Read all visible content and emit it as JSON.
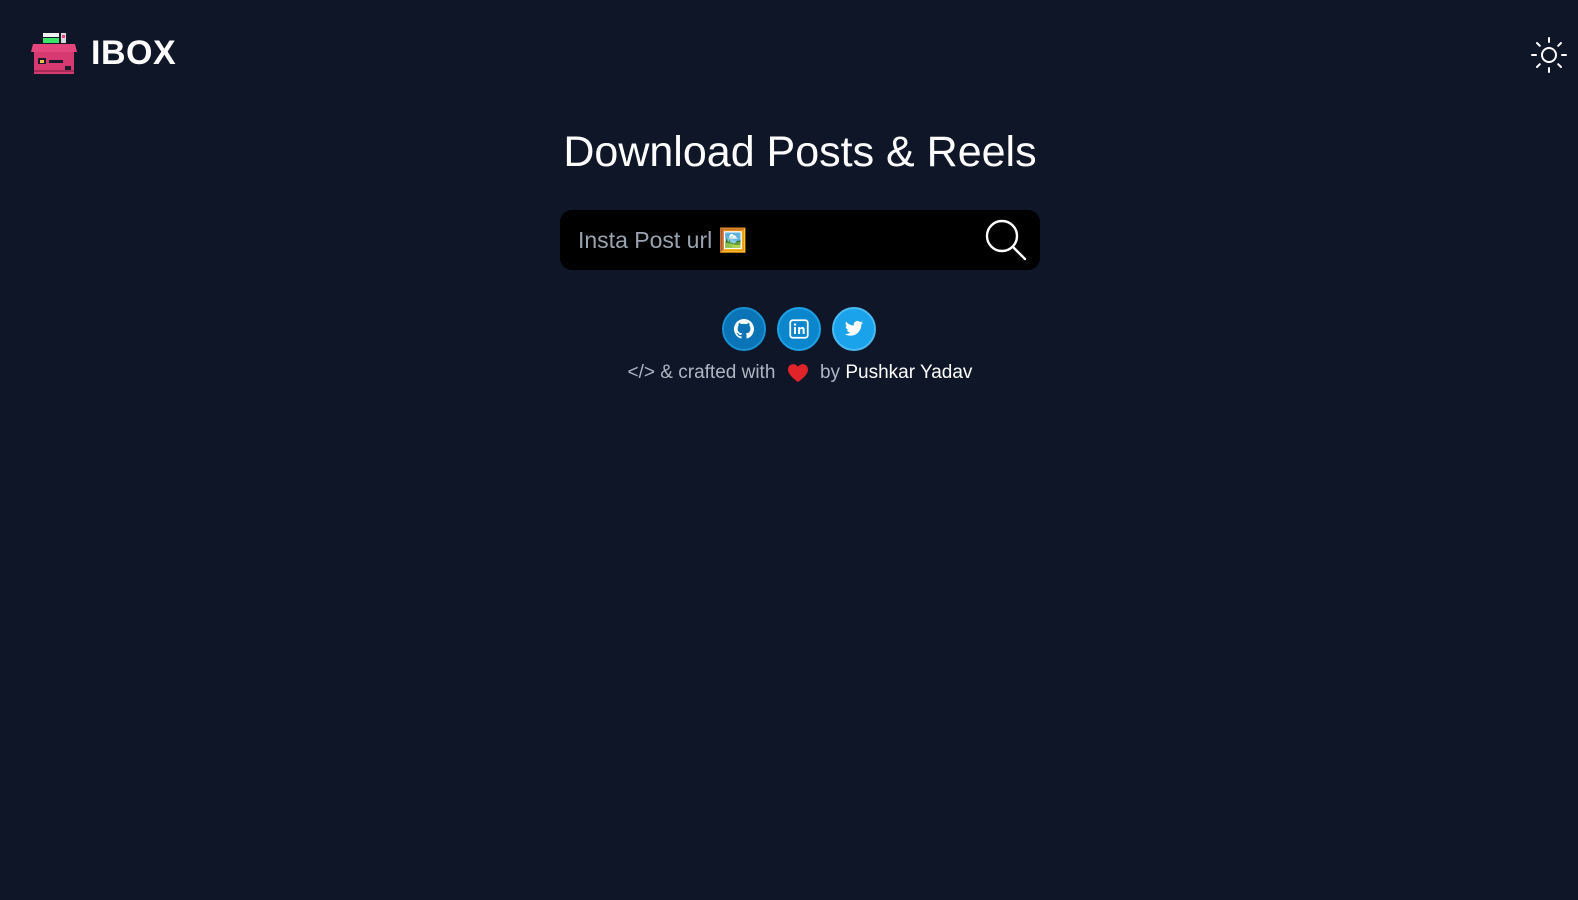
{
  "header": {
    "brand": "IBOX",
    "logo_icon": "store-box-icon",
    "theme_toggle_icon": "sun-icon"
  },
  "main": {
    "title": "Download Posts & Reels",
    "search": {
      "placeholder": "Insta Post url 🖼️",
      "value": "",
      "button_icon": "search-icon"
    },
    "socials": [
      {
        "name": "github",
        "icon": "github-icon"
      },
      {
        "name": "linkedin",
        "icon": "linkedin-icon"
      },
      {
        "name": "twitter",
        "icon": "twitter-icon"
      }
    ],
    "credits": {
      "prefix": "</> & crafted with",
      "heart_icon": "heart-icon",
      "by": "by",
      "author": "Pushkar Yadav"
    }
  },
  "colors": {
    "background": "#0e1628",
    "search_background": "#000000",
    "text": "#ffffff",
    "muted_text": "#aeb6c2",
    "github": "#0a74b6",
    "linkedin": "#0b86cc",
    "twitter": "#1aa3ea",
    "heart": "#e0242a",
    "logo_pink": "#e4457c"
  }
}
